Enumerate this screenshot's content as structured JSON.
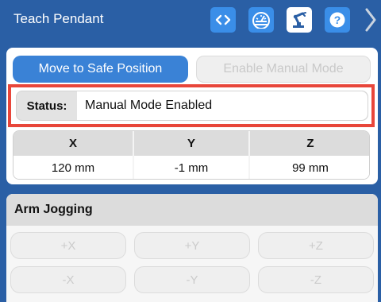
{
  "header": {
    "title": "Teach Pendant",
    "icons": [
      "code-brackets-icon",
      "speedometer-icon",
      "robot-arm-icon",
      "help-icon",
      "chevron-right-icon"
    ]
  },
  "controls": {
    "move_button": "Move to Safe Position",
    "manual_button": "Enable Manual Mode"
  },
  "status": {
    "label": "Status:",
    "value": "Manual Mode Enabled"
  },
  "position": {
    "headers": [
      "X",
      "Y",
      "Z"
    ],
    "values": [
      "120 mm",
      "-1 mm",
      "99 mm"
    ]
  },
  "jogging": {
    "title": "Arm Jogging",
    "buttons": [
      "+X",
      "+Y",
      "+Z",
      "-X",
      "-Y",
      "-Z"
    ]
  },
  "colors": {
    "header_bg": "#2a5fa5",
    "accent": "#3a82d6",
    "highlight_border": "#e8463a"
  }
}
